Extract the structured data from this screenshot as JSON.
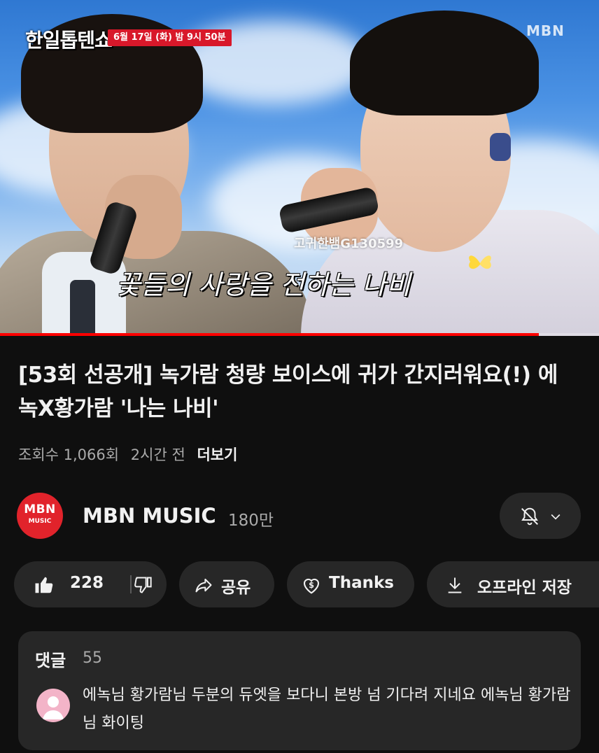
{
  "video": {
    "show_logo": "한일톱텐쇼",
    "air_time": "6월 17일 (화) 밤 9시 50분",
    "channel_watermark": "MBN",
    "fan_watermark": "고귀한뱀G130599",
    "caption": "꽃들의 사랑을 전하는 나비",
    "progress_fraction": 0.9,
    "progress_color": "#ff0000"
  },
  "info": {
    "title": "[53회 선공개] 녹가람 청량 보이스에 귀가 간지러워요(!) 에녹X황가람 '나는 나비'",
    "views": "조회수 1,066회",
    "age": "2시간 전",
    "more_label": "더보기"
  },
  "channel": {
    "avatar_line1": "MBN",
    "avatar_line2": "MUSIC",
    "name": "MBN MUSIC",
    "subscribers": "180만",
    "avatar_color": "#e1232b"
  },
  "actions": {
    "like_count": "228",
    "share_label": "공유",
    "thanks_label": "Thanks",
    "download_label": "오프라인 저장"
  },
  "comments": {
    "header": "댓글",
    "count": "55",
    "top_comment": "에녹님 황가람님 두분의 듀엣을 보다니 본방 넘 기다려 지네요 에녹님 황가람님 화이팅"
  }
}
